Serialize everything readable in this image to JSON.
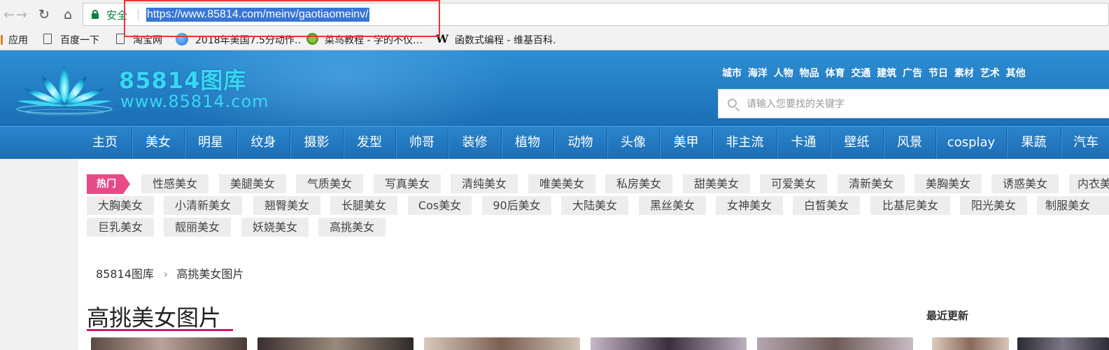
{
  "browser": {
    "secure_label": "安全",
    "url": "https://www.85814.com/meinv/gaotiaomeinv/",
    "bookmarks": [
      {
        "label": "应用",
        "icon": "apps-icon"
      },
      {
        "label": "百度一下",
        "icon": "page-icon"
      },
      {
        "label": "淘宝网",
        "icon": "page-icon"
      },
      {
        "label": "2018年美国7.5分动作…",
        "icon": "globe-icon"
      },
      {
        "label": "菜鸟教程 - 学的不仅…",
        "icon": "cainiao-icon"
      },
      {
        "label": "函数式编程 - 维基百科…",
        "icon": "wikipedia-icon"
      }
    ]
  },
  "header": {
    "logo_name": "85814图库",
    "logo_url": "www.85814.com",
    "quick_links": [
      "城市",
      "海洋",
      "人物",
      "物品",
      "体育",
      "交通",
      "建筑",
      "广告",
      "节日",
      "素材",
      "艺术",
      "其他"
    ],
    "search_placeholder": "请输入您要找的关键字"
  },
  "nav": [
    "主页",
    "美女",
    "明星",
    "纹身",
    "摄影",
    "发型",
    "帅哥",
    "装修",
    "植物",
    "动物",
    "头像",
    "美甲",
    "非主流",
    "卡通",
    "壁纸",
    "风景",
    "cosplay",
    "果蔬",
    "汽车"
  ],
  "hot": {
    "label": "热门",
    "tags": [
      [
        "性感美女",
        "美腿美女",
        "气质美女",
        "写真美女",
        "清纯美女",
        "唯美美女",
        "私房美女",
        "甜美美女",
        "可爱美女",
        "清新美女",
        "美胸美女",
        "诱惑美女",
        "内衣美女"
      ],
      [
        "大胸美女",
        "小清新美女",
        "翘臀美女",
        "长腿美女",
        "Cos美女",
        "90后美女",
        "大陆美女",
        "黑丝美女",
        "女神美女",
        "白皙美女",
        "比基尼美女",
        "阳光美女",
        "制服美女"
      ],
      [
        "巨乳美女",
        "靓丽美女",
        "妖娆美女",
        "高挑美女"
      ]
    ]
  },
  "breadcrumb": {
    "home": "85814图库",
    "current": "高挑美女图片"
  },
  "page_title": "高挑美女图片",
  "recent_label": "最近更新"
}
